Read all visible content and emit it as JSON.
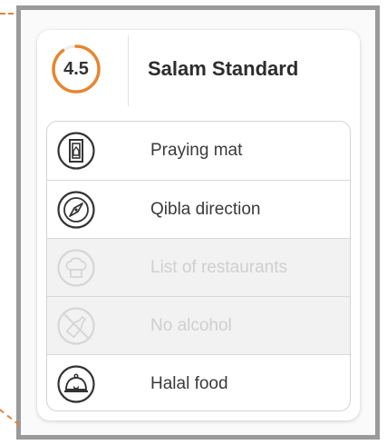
{
  "card": {
    "rating": "4.5",
    "rating_fraction": 0.9,
    "title": "Salam Standard"
  },
  "amenities": [
    {
      "label": "Praying mat",
      "icon": "praying-mat-icon",
      "available": true
    },
    {
      "label": "Qibla direction",
      "icon": "compass-icon",
      "available": true
    },
    {
      "label": "List of restaurants",
      "icon": "chef-hat-icon",
      "available": false
    },
    {
      "label": "No alcohol",
      "icon": "no-alcohol-icon",
      "available": false
    },
    {
      "label": "Halal food",
      "icon": "food-cloche-icon",
      "available": true
    }
  ],
  "colors": {
    "accent": "#e8852f",
    "text": "#333333",
    "disabled_text": "#cfcfcf",
    "disabled_bg": "#f2f2f2"
  }
}
